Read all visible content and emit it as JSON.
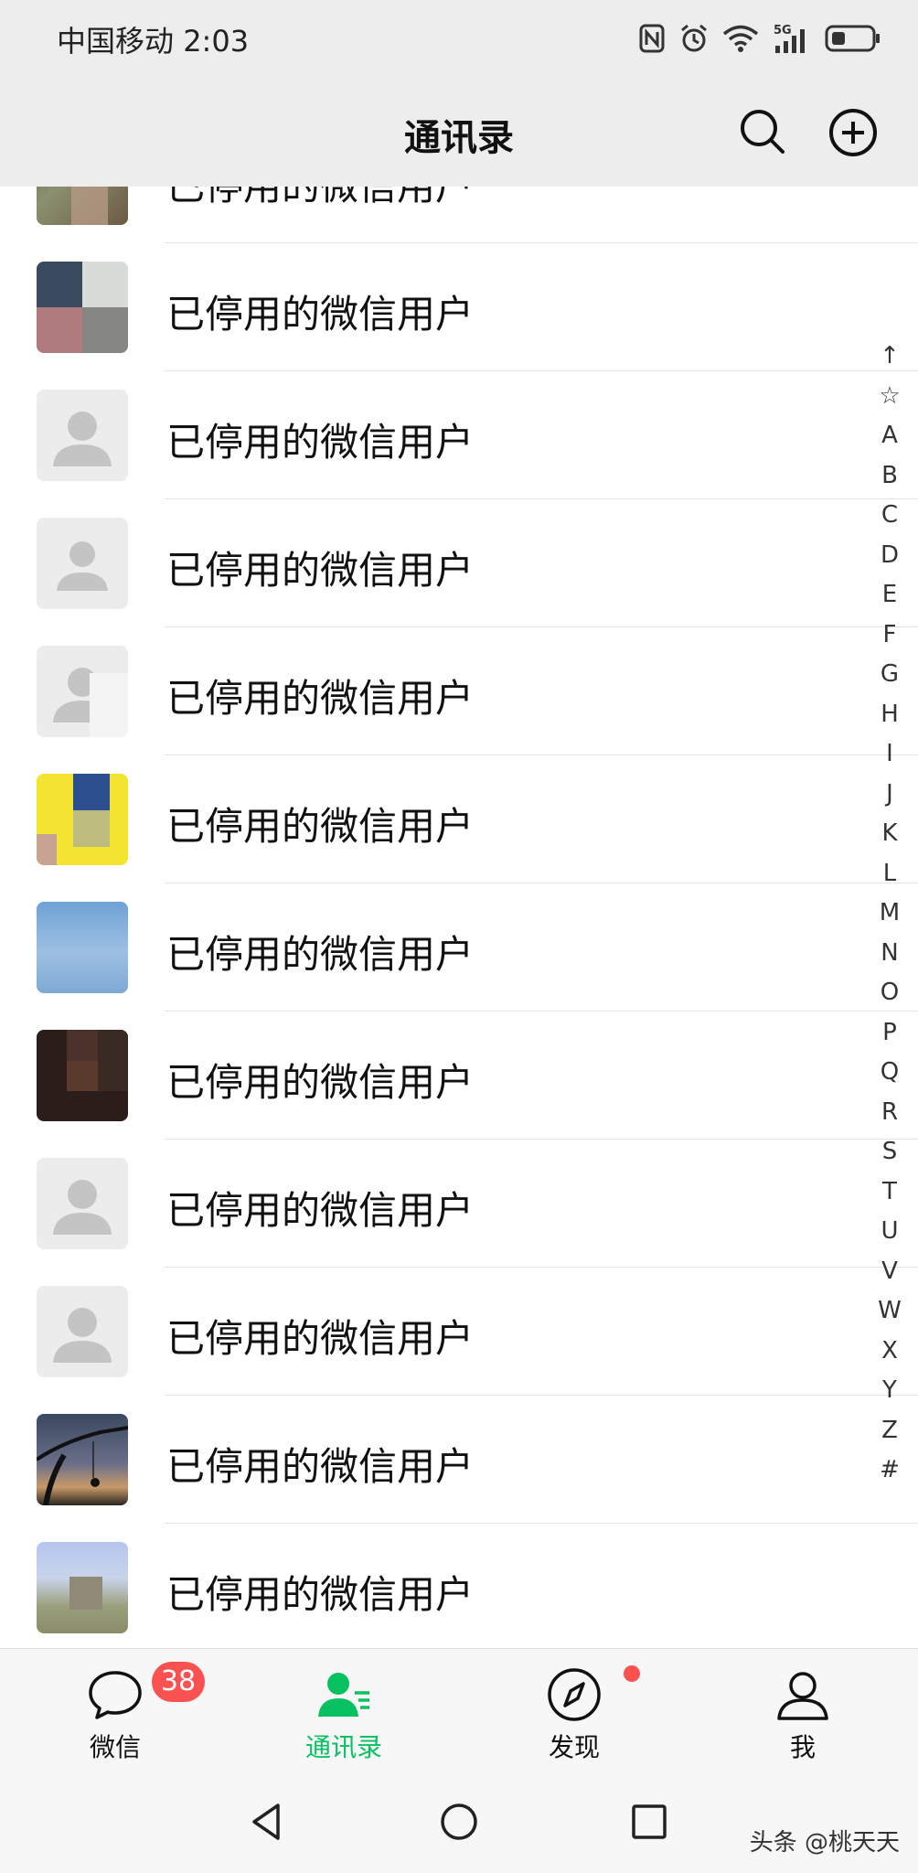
{
  "status_bar": {
    "carrier": "中国移动",
    "time": "2:03",
    "network": "5G",
    "icons": [
      "nfc-icon",
      "alarm-icon",
      "wifi-icon",
      "signal-icon",
      "battery-icon"
    ]
  },
  "header": {
    "title": "通讯录",
    "icons": [
      "search-icon",
      "add-circle-icon"
    ]
  },
  "contacts": [
    {
      "name": "已停用的微信用户",
      "avatar": "photo-olive"
    },
    {
      "name": "已停用的微信用户",
      "avatar": "photo-gray"
    },
    {
      "name": "已停用的微信用户",
      "avatar": "default"
    },
    {
      "name": "已停用的微信用户",
      "avatar": "default"
    },
    {
      "name": "已停用的微信用户",
      "avatar": "default"
    },
    {
      "name": "已停用的微信用户",
      "avatar": "photo-yellow"
    },
    {
      "name": "已停用的微信用户",
      "avatar": "photo-sky"
    },
    {
      "name": "已停用的微信用户",
      "avatar": "photo-dark"
    },
    {
      "name": "已停用的微信用户",
      "avatar": "default"
    },
    {
      "name": "已停用的微信用户",
      "avatar": "default"
    },
    {
      "name": "已停用的微信用户",
      "avatar": "photo-sunset"
    },
    {
      "name": "已停用的微信用户",
      "avatar": "photo-flowers"
    }
  ],
  "index_letters": [
    "↑",
    "☆",
    "A",
    "B",
    "C",
    "D",
    "E",
    "F",
    "G",
    "H",
    "I",
    "J",
    "K",
    "L",
    "M",
    "N",
    "O",
    "P",
    "Q",
    "R",
    "S",
    "T",
    "U",
    "V",
    "W",
    "X",
    "Y",
    "Z",
    "#"
  ],
  "tabs": [
    {
      "label": "微信",
      "icon": "chat-bubble-icon",
      "badge": "38"
    },
    {
      "label": "通讯录",
      "icon": "contacts-icon",
      "active": true
    },
    {
      "label": "发现",
      "icon": "compass-icon",
      "dot": true
    },
    {
      "label": "我",
      "icon": "person-icon"
    }
  ],
  "system_nav": [
    "back-icon",
    "home-icon",
    "recents-icon"
  ],
  "watermark": "头条 @桃天天",
  "colors": {
    "accent": "#07c160",
    "badge": "#fa5151",
    "header_bg": "#ededed",
    "tabbar_bg": "#f7f7f7"
  }
}
